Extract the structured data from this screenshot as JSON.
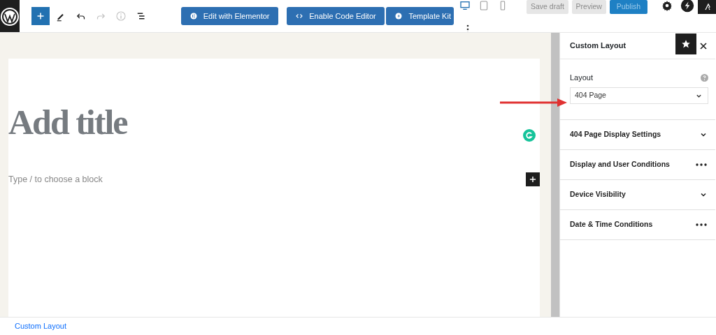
{
  "toolbar": {
    "tools": [
      {
        "kind": "add",
        "disabled": false
      },
      {
        "kind": "pen",
        "disabled": false
      },
      {
        "kind": "undo",
        "disabled": false
      },
      {
        "kind": "redo",
        "disabled": true
      },
      {
        "kind": "info",
        "disabled": true
      },
      {
        "kind": "list",
        "disabled": false
      }
    ],
    "buttons": [
      {
        "label": "Edit with Elementor",
        "kind": "elementor"
      },
      {
        "label": "Enable Code Editor",
        "kind": "code"
      },
      {
        "label": "Template Kit",
        "kind": "kit"
      }
    ],
    "devices": [
      {
        "kind": "desktop",
        "selected": true
      },
      {
        "kind": "tablet",
        "selected": false
      },
      {
        "kind": "mobile",
        "selected": false
      }
    ],
    "actions": [
      {
        "label": "Save draft",
        "kind": "secondary"
      },
      {
        "label": "Preview",
        "kind": "secondary"
      },
      {
        "label": "Publish",
        "kind": "primary"
      }
    ]
  },
  "editor": {
    "title_placeholder": "Add title",
    "block_placeholder": "Type / to choose a block"
  },
  "sidebar": {
    "title": "Custom Layout",
    "layout": {
      "label": "Layout",
      "value": "404 Page"
    },
    "sections": [
      {
        "title": "404 Page Display Settings",
        "kind": "collapse"
      },
      {
        "title": "Display and User Conditions",
        "kind": "menu"
      },
      {
        "title": "Device Visibility",
        "kind": "collapse"
      },
      {
        "title": "Date & Time Conditions",
        "kind": "menu"
      }
    ]
  },
  "footer": {
    "breadcrumb": "Custom Layout"
  }
}
